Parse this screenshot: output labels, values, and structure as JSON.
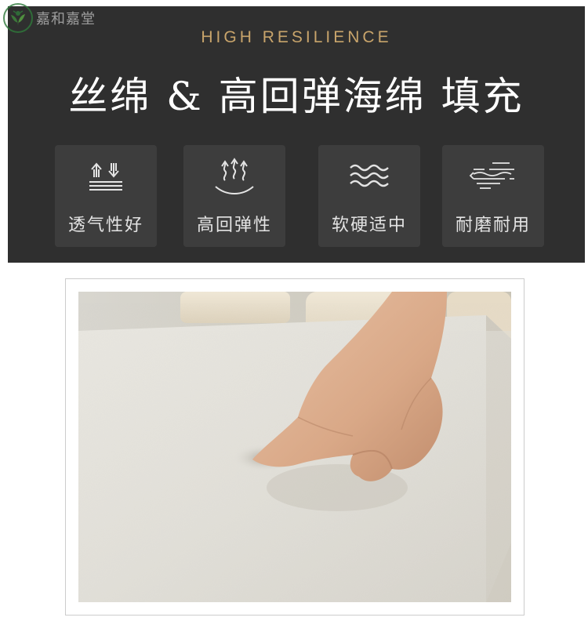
{
  "brand": {
    "logo_text": "嘉和嘉堂",
    "logo_icon": "leaf-circle-icon"
  },
  "banner": {
    "eyebrow": "HIGH RESILIENCE",
    "headline": "丝绵 & 高回弹海绵 填充"
  },
  "features": [
    {
      "label": "透气性好",
      "icon": "breathable-arrows-icon"
    },
    {
      "label": "高回弹性",
      "icon": "rebound-arrows-icon"
    },
    {
      "label": "软硬适中",
      "icon": "waves-icon"
    },
    {
      "label": "耐磨耐用",
      "icon": "wind-lines-icon"
    }
  ],
  "colors": {
    "panel": "#2f2f2f",
    "tile": "#3d3d3d",
    "accent": "#c8a46b",
    "logo_green": "#2f7a3b"
  },
  "photo": {
    "subject": "hand-pressing-foam-image"
  }
}
